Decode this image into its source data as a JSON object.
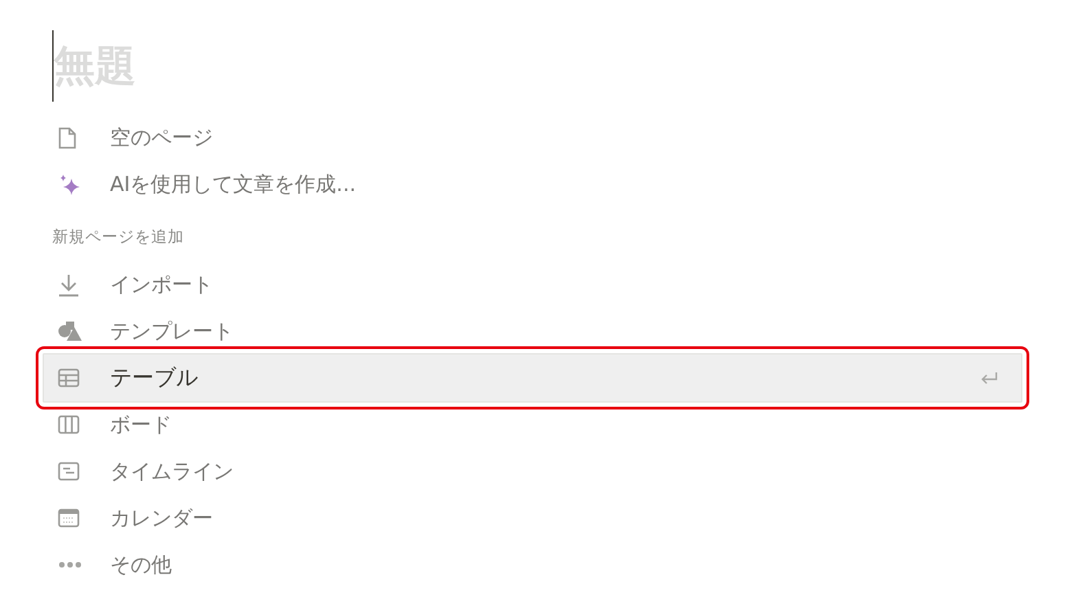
{
  "title": {
    "placeholder": "無題"
  },
  "top_items": [
    {
      "kind": "page",
      "label": "空のページ"
    },
    {
      "kind": "ai",
      "label": "AIを使用して文章を作成..."
    }
  ],
  "section": {
    "heading": "新規ページを追加",
    "items": [
      {
        "kind": "import",
        "label": "インポート",
        "selected": false
      },
      {
        "kind": "template",
        "label": "テンプレート",
        "selected": false
      },
      {
        "kind": "table",
        "label": "テーブル",
        "selected": true
      },
      {
        "kind": "board",
        "label": "ボード",
        "selected": false
      },
      {
        "kind": "timeline",
        "label": "タイムライン",
        "selected": false
      },
      {
        "kind": "calendar",
        "label": "カレンダー",
        "selected": false
      },
      {
        "kind": "more",
        "label": "その他",
        "selected": false
      }
    ]
  }
}
